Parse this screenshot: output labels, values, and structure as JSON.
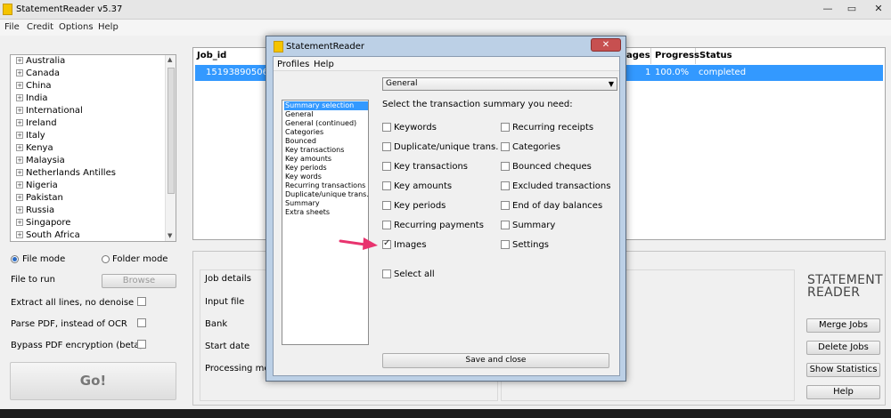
{
  "window": {
    "title": "StatementReader v5.37",
    "minimize": "—",
    "maximize": "▭",
    "close": "✕"
  },
  "menu": [
    "File",
    "Credit",
    "Options",
    "Help"
  ],
  "countries": [
    "Australia",
    "Canada",
    "China",
    "India",
    "International",
    "Ireland",
    "Italy",
    "Kenya",
    "Malaysia",
    "Netherlands Antilles",
    "Nigeria",
    "Pakistan",
    "Russia",
    "Singapore",
    "South Africa"
  ],
  "left": {
    "file_mode": "File mode",
    "folder_mode": "Folder mode",
    "file_to_run": "File to run",
    "browse": "Browse",
    "extract_lines": "Extract all lines, no denoise",
    "parse_pdf": "Parse PDF, instead of OCR",
    "bypass": "Bypass PDF encryption (beta)",
    "go": "Go!"
  },
  "table": {
    "headers": {
      "job_id": "Job_id",
      "pages": "ages",
      "progress": "Progress",
      "status": "Status"
    },
    "row": {
      "job_id": "15193890506",
      "pages": "1",
      "progress": "100.0%",
      "status": "completed"
    }
  },
  "details": {
    "labels": [
      "Job details",
      "Input file",
      "Bank",
      "Start date",
      "Processing me"
    ]
  },
  "brand": {
    "line1": "STATEMENT",
    "line2": "READER"
  },
  "right_buttons": [
    "Merge Jobs",
    "Delete Jobs",
    "Show Statistics",
    "Help"
  ],
  "dialog": {
    "title": "StatementReader",
    "close": "✕",
    "menu": [
      "Profiles",
      "Help"
    ],
    "sections": [
      "Summary selection",
      "General",
      "General (continued)",
      "Categories",
      "Bounced",
      "Key transactions",
      "Key amounts",
      "Key periods",
      "Key words",
      "Recurring transactions",
      "Duplicate/unique trans.",
      "Summary",
      "Extra sheets"
    ],
    "selected_section": "Summary selection",
    "select_value": "General",
    "prompt": "Select the transaction summary you need:",
    "left_checks": [
      {
        "label": "Keywords",
        "checked": false
      },
      {
        "label": "Duplicate/unique trans.",
        "checked": false
      },
      {
        "label": "Key transactions",
        "checked": false
      },
      {
        "label": "Key amounts",
        "checked": false
      },
      {
        "label": "Key periods",
        "checked": false
      },
      {
        "label": "Recurring payments",
        "checked": false
      },
      {
        "label": "Images",
        "checked": true
      }
    ],
    "right_checks": [
      {
        "label": "Recurring receipts",
        "checked": false
      },
      {
        "label": "Categories",
        "checked": false
      },
      {
        "label": "Bounced cheques",
        "checked": false
      },
      {
        "label": "Excluded transactions",
        "checked": false
      },
      {
        "label": "End of day balances",
        "checked": false
      },
      {
        "label": "Summary",
        "checked": false
      },
      {
        "label": "Settings",
        "checked": false
      }
    ],
    "select_all": "Select all",
    "save": "Save and close"
  },
  "colors": {
    "selection": "#3399ff",
    "arrow": "#e8336e",
    "accent": "#f5c400"
  }
}
